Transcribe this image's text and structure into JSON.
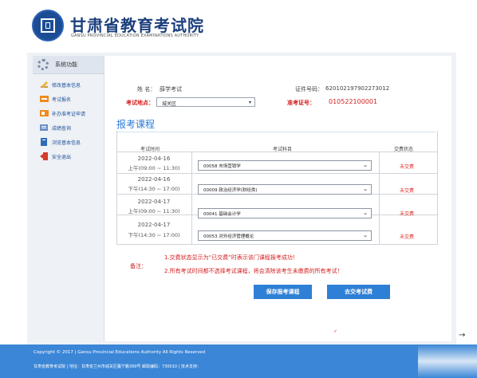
{
  "header": {
    "title": "甘肃省教育考试院",
    "subtitle": "GANSU PROVINCIAL EDUCATION EXAMINATIONS AUTHORITY"
  },
  "sidebar": {
    "heading": "系统功能",
    "items": [
      {
        "label": "修改基本信息",
        "icon": "pencil-icon"
      },
      {
        "label": "考试报名",
        "icon": "register-icon"
      },
      {
        "label": "补办准考证申请",
        "icon": "id-card-icon"
      },
      {
        "label": "成绩查询",
        "icon": "score-icon"
      },
      {
        "label": "浏览基本信息",
        "icon": "book-icon"
      },
      {
        "label": "安全退出",
        "icon": "logout-icon"
      }
    ]
  },
  "profile": {
    "name_label": "姓  名：",
    "name_value": "薛学考试",
    "id_label": "证件号码：",
    "id_value": "620102197902273012",
    "location_label": "考试地点：",
    "location_value": "城关区",
    "admission_label": "准考证号：",
    "admission_value": "010522100001"
  },
  "section_title": "报考课程",
  "table": {
    "headers": [
      "考试时间",
      "考试科目",
      "交费状态"
    ],
    "rows": [
      {
        "date": "2022-04-16",
        "time": "上午(09:00 ~ 11:30)",
        "course": "00058 市场营销学",
        "status": "未交费"
      },
      {
        "date": "2022-04-16",
        "time": "下午(14:30 ~ 17:00)",
        "course": "00009 政治经济学(财经类)",
        "status": "未交费"
      },
      {
        "date": "2022-04-17",
        "time": "上午(09:00 ~ 11:30)",
        "course": "00041 基础会计学",
        "status": "未交费"
      },
      {
        "date": "2022-04-17",
        "time": "下午(14:30 ~ 17:00)",
        "course": "00053 对外经济管理概论",
        "status": "未交费"
      }
    ]
  },
  "notes": {
    "label": "备注：",
    "lines": [
      "1.交费状态显示为“已交费”时表示该门课程报考成功！",
      "2.所有考试时间都不选择考试课程，将会清除该考生未缴费的所有考试！"
    ]
  },
  "buttons": {
    "save": "保存报考课程",
    "pay": "去交考试费"
  },
  "footer": {
    "copyright": "Copyright © 2017 | Gansu Provincial Educations Authority All Rights Reserved",
    "address": "甘肃省教育考试院 | 地址：甘肃省兰州市城关区雁宁路399号 邮政编码：730010 | 技术支持："
  },
  "colors": {
    "brand_blue": "#1c3f7c",
    "accent_blue": "#2e7fd6",
    "alert_red": "#d42020",
    "footer_blue": "#3b86d6"
  }
}
